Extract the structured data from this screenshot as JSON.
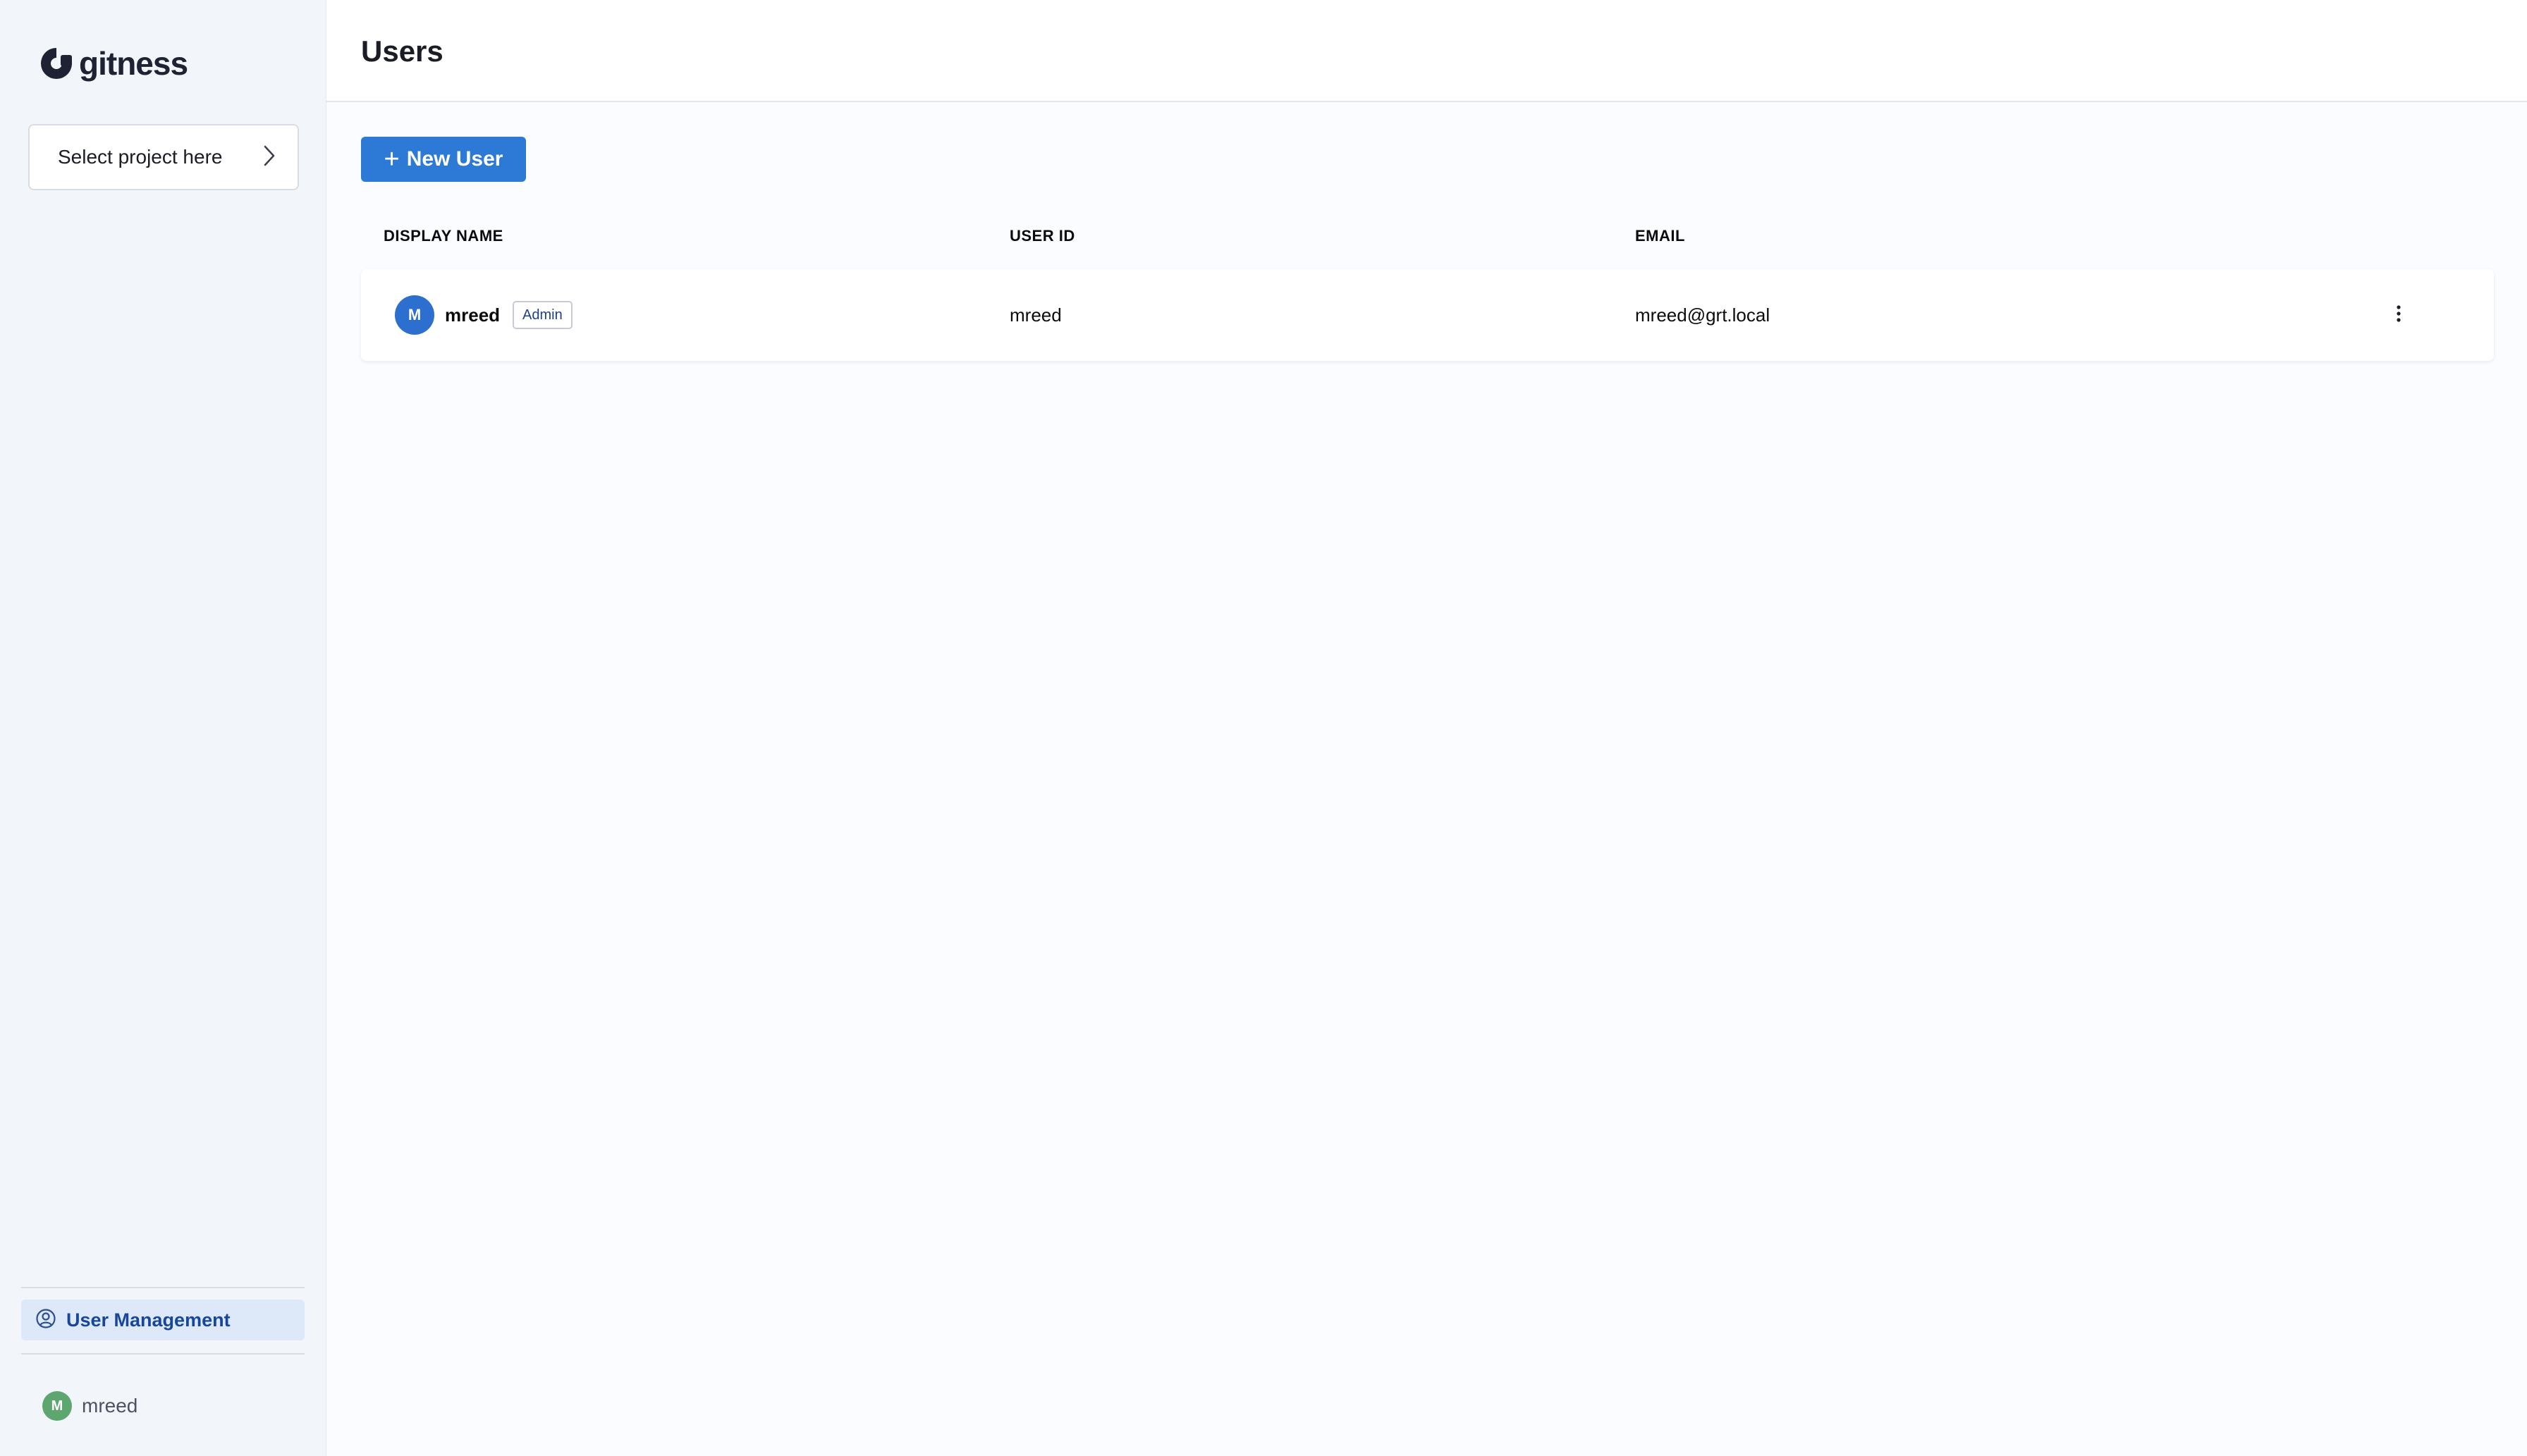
{
  "brand": {
    "name": "gitness",
    "logo_icon": "gitness-logo-icon"
  },
  "sidebar": {
    "project_select": {
      "label": "Select project here",
      "icon": "chevron-right-icon"
    },
    "nav_items": [
      {
        "label": "User Management",
        "icon": "user-circle-icon",
        "active": true
      }
    ],
    "current_user": {
      "initial": "M",
      "name": "mreed"
    }
  },
  "header": {
    "title": "Users"
  },
  "toolbar": {
    "new_user_label": "New User",
    "new_user_icon": "plus-icon"
  },
  "table": {
    "columns": [
      "DISPLAY NAME",
      "USER ID",
      "EMAIL"
    ],
    "rows": [
      {
        "avatar_initial": "M",
        "display_name": "mreed",
        "badge": "Admin",
        "user_id": "mreed",
        "email": "mreed@grt.local",
        "menu_icon": "more-vertical-icon"
      }
    ]
  },
  "colors": {
    "accent": "#2d7ad6",
    "sidebar_bg": "#f2f5fa",
    "active_nav_bg": "#dde8f8",
    "active_nav_text": "#17479b",
    "current_user_avatar": "#5ea66f",
    "row_avatar": "#2d6fcf"
  }
}
